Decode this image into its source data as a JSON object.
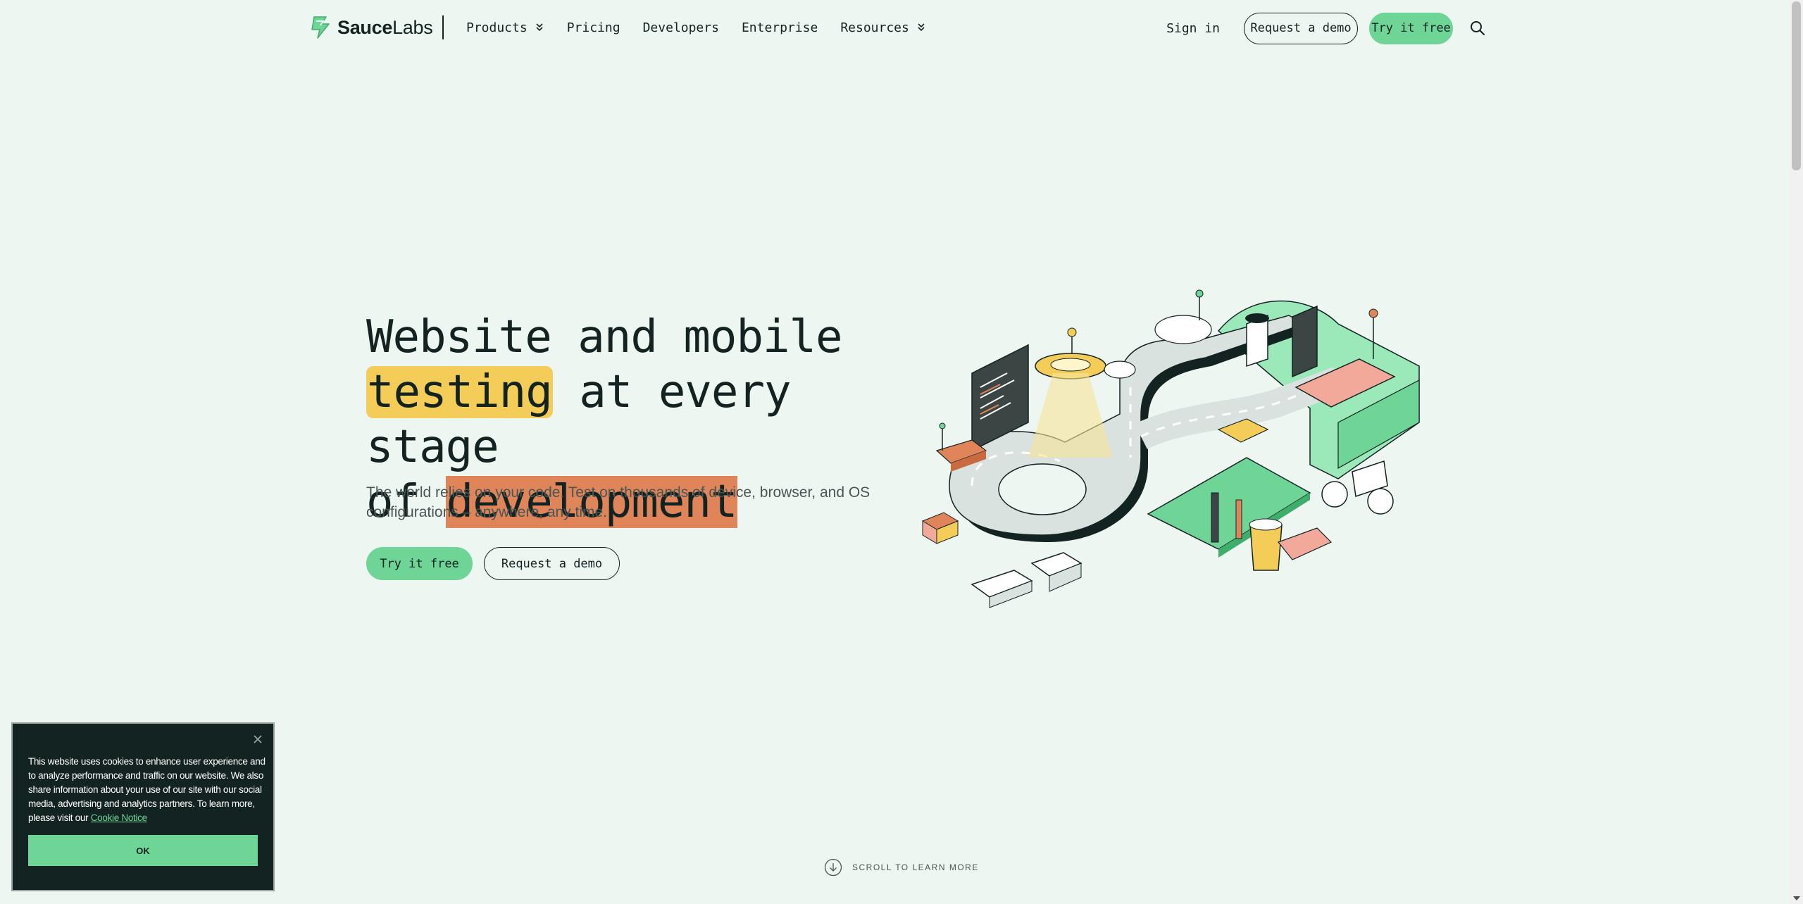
{
  "header": {
    "logo": {
      "text_bold": "Sauce",
      "text_regular": "Labs"
    },
    "nav": [
      {
        "label": "Products",
        "has_dropdown": true
      },
      {
        "label": "Pricing",
        "has_dropdown": false
      },
      {
        "label": "Developers",
        "has_dropdown": false
      },
      {
        "label": "Enterprise",
        "has_dropdown": false
      },
      {
        "label": "Resources",
        "has_dropdown": true
      }
    ],
    "sign_in": "Sign in",
    "request_demo": "Request a demo",
    "try_free": "Try it free"
  },
  "hero": {
    "title_line1": "Website and mobile",
    "title_highlight1": "testing",
    "title_middle": " at every stage",
    "title_prefix3": "of ",
    "title_highlight2": "development",
    "subtitle": "The world relies on your code. Test on thousands of device, browser, and OS configurations – anywhere, any time.",
    "cta_primary": "Try it free",
    "cta_secondary": "Request a demo"
  },
  "scroll_hint": "SCROLL TO LEARN MORE",
  "cookie_banner": {
    "text": "This website uses cookies to enhance user experience and to analyze performance and traffic on our website. We also share information about your use of our site with our social media, advertising and analytics partners. To learn more, please visit our ",
    "link": "Cookie Notice",
    "ok": "OK"
  },
  "colors": {
    "background": "#eef6f2",
    "primary_green": "#6fd596",
    "highlight_yellow": "#f3cd58",
    "highlight_orange": "#e0855a",
    "dark": "#132322"
  },
  "icons": [
    "logo-mark-icon",
    "chevron-double-down-icon",
    "search-icon",
    "scroll-down-circle-icon",
    "close-icon"
  ]
}
